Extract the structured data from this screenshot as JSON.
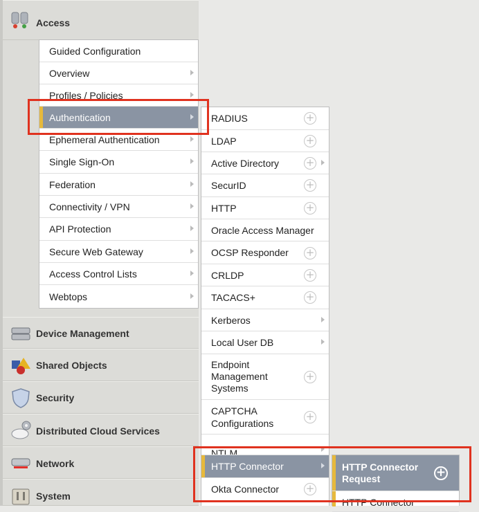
{
  "sidebar": {
    "sections": [
      {
        "label": "Access",
        "icon": "access-icon"
      },
      {
        "label": "Device Management",
        "icon": "device-management-icon"
      },
      {
        "label": "Shared Objects",
        "icon": "shared-objects-icon"
      },
      {
        "label": "Security",
        "icon": "shield-icon"
      },
      {
        "label": "Distributed Cloud Services",
        "icon": "cloud-gear-icon"
      },
      {
        "label": "Network",
        "icon": "network-icon"
      },
      {
        "label": "System",
        "icon": "system-icon"
      }
    ]
  },
  "access_menu": {
    "items": [
      {
        "label": "Guided Configuration"
      },
      {
        "label": "Overview"
      },
      {
        "label": "Profiles / Policies"
      },
      {
        "label": "Authentication"
      },
      {
        "label": "Ephemeral Authentication"
      },
      {
        "label": "Single Sign-On"
      },
      {
        "label": "Federation"
      },
      {
        "label": "Connectivity / VPN"
      },
      {
        "label": "API Protection"
      },
      {
        "label": "Secure Web Gateway"
      },
      {
        "label": "Access Control Lists"
      },
      {
        "label": "Webtops"
      }
    ]
  },
  "auth_menu": {
    "items": [
      {
        "label": "RADIUS"
      },
      {
        "label": "LDAP"
      },
      {
        "label": "Active Directory"
      },
      {
        "label": "SecurID"
      },
      {
        "label": "HTTP"
      },
      {
        "label": "Oracle Access Manager"
      },
      {
        "label": "OCSP Responder"
      },
      {
        "label": "CRLDP"
      },
      {
        "label": "TACACS+"
      },
      {
        "label": "Kerberos"
      },
      {
        "label": "Local User DB"
      },
      {
        "label": "Endpoint\nManagement\nSystems"
      },
      {
        "label": "CAPTCHA\nConfigurations"
      },
      {
        "label": "NTLM"
      },
      {
        "label": "HTTP Connector"
      },
      {
        "label": "Okta Connector"
      }
    ]
  },
  "http_connector_menu": {
    "items": [
      {
        "label": "HTTP Connector\nRequest"
      },
      {
        "label": "HTTP Connector"
      }
    ]
  },
  "icons": {
    "plus": "+"
  },
  "colors": {
    "selected_bg": "#8a94a3",
    "selected_accent": "#e7b93c",
    "highlight_box": "#e0321f"
  }
}
